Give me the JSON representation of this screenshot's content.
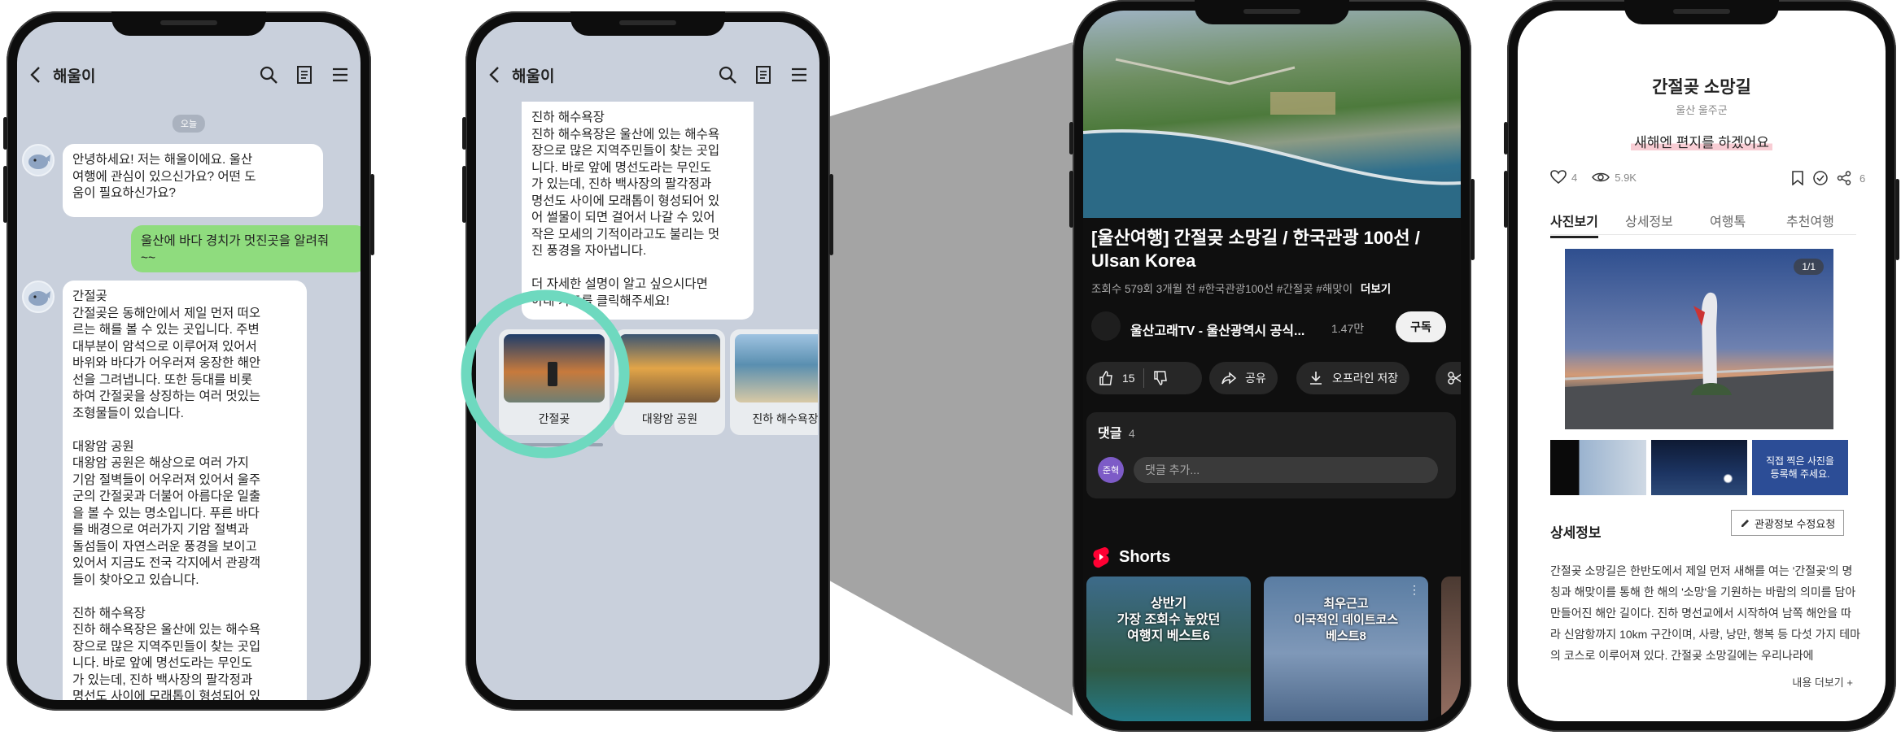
{
  "chatbot_screen": {
    "title": "해울이",
    "date_label": "오늘",
    "messages": [
      {
        "sender": "bot",
        "text": "안녕하세요! 저는 해울이에요. 울산\n여행에 관심이 있으신가요? 어떤 도\n움이 필요하신가요?"
      },
      {
        "sender": "user",
        "text": "울산에 바다 경치가 멋진곳을 알려줘\n~~"
      },
      {
        "sender": "bot",
        "text": "간절곶\n간절곶은 동해안에서 제일 먼저 떠오\n르는 해를 볼 수 있는 곳입니다. 주변\n대부분이 암석으로 이루어져 있어서\n바위와 바다가 어우러져 웅장한 해안\n선을 그려냅니다. 또한 등대를 비롯\n하여 간절곶을 상징하는 여러 멋있는\n조형물들이 있습니다.\n\n대왕암 공원\n대왕암 공원은 해상으로 여러 가지\n기암 절벽들이 어우러져 있어서 울주\n군의 간절곶과 더불어 아름다운 일출\n을 볼 수 있는 명소입니다. 푸른 바다\n를 배경으로 여러가지 기암 절벽과\n돌섬들이 자연스러운 풍경을 보이고\n있어서 지금도 전국 각지에서 관광객\n들이 찾아오고 있습니다.\n\n진하 해수욕장\n진하 해수욕장은 울산에 있는 해수욕\n장으로 많은 지역주민들이 찾는 곳입\n니다. 바로 앞에 명선도라는 무인도\n가 있는데, 진하 백사장의 팔각정과\n명선도 사이에 모래톱이 형성되어 있\n어 썰물이 되면 걸어서 나갈 수 있어"
      }
    ]
  },
  "cards_screen": {
    "title": "해울이",
    "message_text": "진하 해수욕장\n진하 해수욕장은 울산에 있는 해수욕\n장으로 많은 지역주민들이 찾는 곳입\n니다. 바로 앞에 명선도라는 무인도\n가 있는데, 진하 백사장의 팔각정과\n명선도 사이에 모래톱이 형성되어 있\n어 썰물이 되면 걸어서 나갈 수 있어\n작은 모세의 기적이라고도 불리는 멋\n진 풍경을 자아냅니다.\n\n더 자세한 설명이 알고 싶으시다면\n아래 카드를 클릭해주세요!",
    "cards": [
      "간절곶",
      "대왕암 공원",
      "진하 해수욕장"
    ]
  },
  "youtube_screen": {
    "video_title": "[울산여행] 간절곶 소망길 / 한국관광 100선 / Ulsan Korea",
    "meta": "조회수 579회  3개월 전  #한국관광100선  #간절곶  #해맞이",
    "more_label": "더보기",
    "channel_name": "울산고래TV - 울산광역시 공식...",
    "subscriber_count": "1.47만",
    "subscribe_label": "구독",
    "like_count": "15",
    "share_label": "공유",
    "offline_label": "오프라인 저장",
    "comments_label": "댓글",
    "comments_count": "4",
    "commenter_initials": "준혁",
    "comment_placeholder": "댓글 추가...",
    "shorts_label": "Shorts",
    "shorts": [
      {
        "title": "상반기\n가장 조회수 높았던\n여행지 베스트6"
      },
      {
        "title": "최우근고\n이국적인 데이트코스\n베스트8"
      }
    ],
    "colors": {
      "accent": "#ff0033",
      "background": "#0f0f0f"
    }
  },
  "tourism_screen": {
    "title": "간절곶 소망길",
    "location": "울산 울주군",
    "tagline": "새해엔 편지를 하겠어요",
    "like_count": "4",
    "view_count": "5.9K",
    "share_count": "6",
    "tabs": [
      "사진보기",
      "상세정보",
      "여행톡",
      "추천여행"
    ],
    "active_tab": 0,
    "photo_counter": "1/1",
    "upload_prompt": "직접 찍은 사진을\n등록해 주세요.",
    "section_title": "상세정보",
    "edit_button": "관광정보 수정요청",
    "description": "간절곶 소망길은 한반도에서 제일 먼저 새해를 여는 '간절곶'의 명칭과 해맞이를 통해 한 해의 '소망'을 기원하는 바람의 의미를 담아 만들어진 해안 길이다. 진하 명선교에서 시작하여 남쪽 해안을 따라 신암항까지 10km 구간이며, 사랑, 낭만, 행복 등 다섯 가지 테마의 코스로 이루어져 있다. 간절곶 소망길에는 우리나라에",
    "more_label": "내용 더보기",
    "colors": {
      "tab_underline": "#222222",
      "tagline_highlight": "#f8cdd4"
    }
  },
  "callout": {
    "color": "#6ed9bf"
  }
}
